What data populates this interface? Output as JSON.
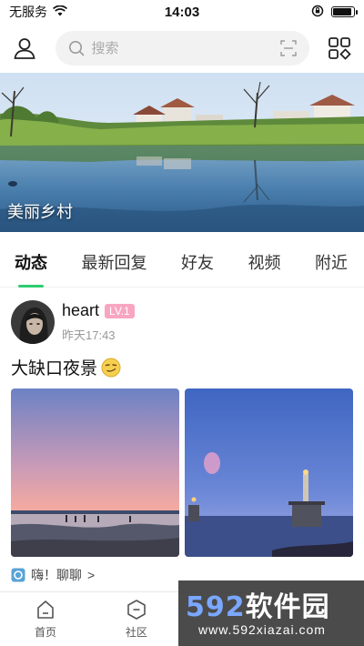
{
  "status_bar": {
    "carrier": "无服务",
    "time": "14:03",
    "battery_level": 0.9
  },
  "header": {
    "search_placeholder": "搜索",
    "icons": [
      "user-icon",
      "search-icon",
      "scan-icon",
      "apps-icon"
    ]
  },
  "banner": {
    "caption": "美丽乡村"
  },
  "tabs": [
    {
      "label": "动态",
      "active": true
    },
    {
      "label": "最新回复",
      "active": false
    },
    {
      "label": "好友",
      "active": false
    },
    {
      "label": "视频",
      "active": false
    },
    {
      "label": "附近",
      "active": false
    }
  ],
  "post": {
    "username": "heart",
    "level": "LV.1",
    "time": "昨天17:43",
    "text": "大缺口夜景",
    "topic": "嗨！聊聊",
    "topic_arrow": ">"
  },
  "bottom_nav": [
    {
      "label": "首页",
      "icon": "home-icon"
    },
    {
      "label": "社区",
      "icon": "community-icon"
    }
  ],
  "watermark": {
    "number": "592",
    "cn": "软件园",
    "url": "www.592xiazai.com"
  },
  "colors": {
    "accent": "#2ecc71",
    "level_badge": "#f8a5c2",
    "search_bg": "#f2f2f2"
  }
}
